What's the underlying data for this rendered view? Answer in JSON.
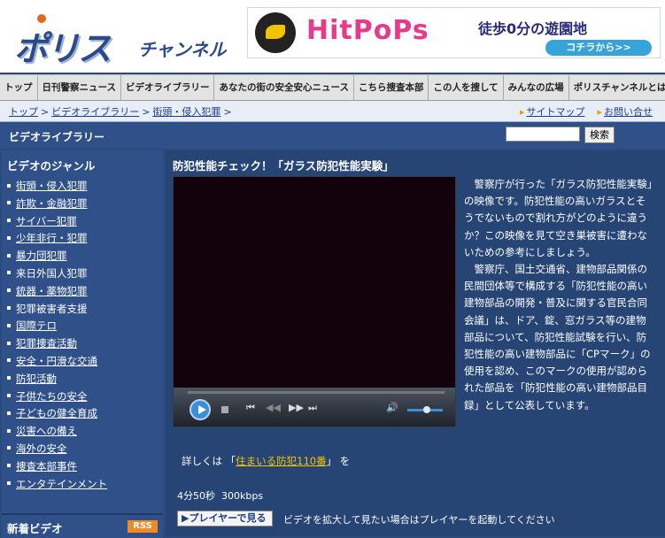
{
  "header": {
    "logo_text": "ポリス",
    "logo_sub": "チャンネル",
    "banner": {
      "brand": "HitPoPs",
      "tagline": "徒歩0分の遊園地",
      "button": "コチラから>>"
    }
  },
  "nav": {
    "items": [
      "トップ",
      "日刊警察ニュース",
      "ビデオライブラリー",
      "あなたの街の安全安心ニュース",
      "こちら捜査本部",
      "この人を捜して",
      "みんなの広場",
      "ポリスチャンネルとは"
    ]
  },
  "breadcrumb": {
    "items": [
      "トップ",
      "ビデオライブラリー",
      "街頭・侵入犯罪"
    ],
    "sep": ">"
  },
  "toplinks": {
    "sitemap": "サイトマップ",
    "contact": "お問い合せ"
  },
  "section": {
    "title": "ビデオライブラリー"
  },
  "search": {
    "value": "",
    "button": "検索"
  },
  "sidebar": {
    "title": "ビデオのジャンル",
    "genres": [
      "街頭・侵入犯罪",
      "詐欺・金融犯罪",
      "サイバー犯罪",
      "少年非行・犯罪",
      "暴力団犯罪",
      "来日外国人犯罪",
      "銃器・薬物犯罪",
      "犯罪被害者支援",
      "国際テロ",
      "犯罪捜査活動",
      "安全・円滑な交通",
      "防犯活動",
      "子供たちの安全",
      "子どもの健全育成",
      "災害への備え",
      "海外の安全",
      "捜査本部事件",
      "エンタテインメント"
    ],
    "new_title": "新着ビデオ",
    "rss": "RSS"
  },
  "video": {
    "title": "防犯性能チェック！「ガラス防犯性能実験」",
    "description_p1": "警察庁が行った「ガラス防犯性能実験」の映像です。防犯性能の高いガラスとそうでないもので割れ方がどのように違うか？この映像を見て空き巣被害に遭わないための参考にしましょう。",
    "description_p2": "警察庁、国土交通省、建物部品関係の民間団体等で構成する「防犯性能の高い建物部品の開発・普及に関する官民合同会議」は、ドア、錠、窓ガラス等の建物部品について、防犯性能試験を行い、防犯性能の高い建物部品に「CPマーク」の使用を認め、このマークの使用が認められた部品を「防犯性能の高い建物部品目録」として公表しています。",
    "more_prefix": "詳しくは 「",
    "more_link": "住まいる防犯110番",
    "more_suffix": "」 を",
    "duration": "4分50秒",
    "bitrate": "300kbps",
    "player_button": "プレイヤーで見る",
    "player_note": "ビデオを拡大して見たい場合はプレイヤーを起動してください"
  }
}
